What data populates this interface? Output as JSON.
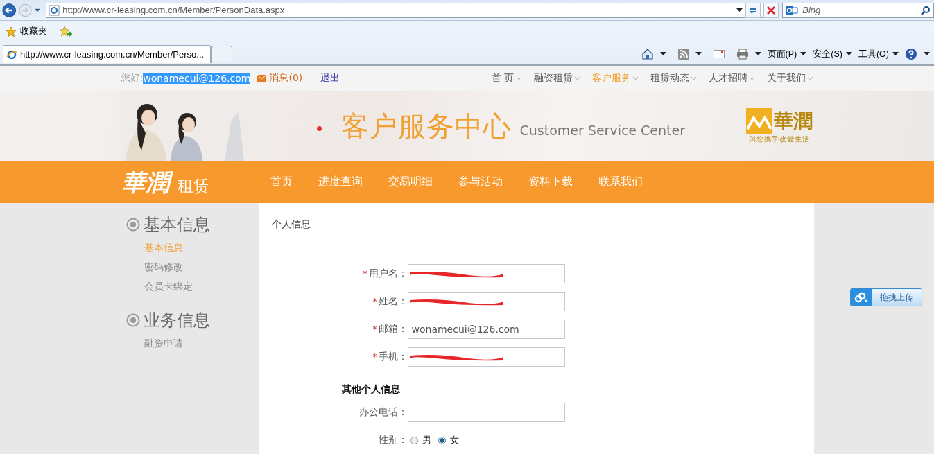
{
  "browser": {
    "address": "http://www.cr-leasing.com.cn/Member/PersonData.aspx",
    "search_placeholder": "Bing",
    "favorites_label": "收藏夹",
    "tab_title": "http://www.cr-leasing.com.cn/Member/Perso...",
    "command_menus": [
      "页面(P)",
      "安全(S)",
      "工具(O)"
    ]
  },
  "top_bar": {
    "greeting": "您好:",
    "username": "wonamecui@126.com",
    "username_selected": true,
    "messages": "消息(0)",
    "logout": "退出",
    "menu": [
      {
        "label": "首 页",
        "selected": false
      },
      {
        "label": "融资租赁",
        "selected": false
      },
      {
        "label": "客户服务",
        "selected": true
      },
      {
        "label": "租赁动态",
        "selected": false
      },
      {
        "label": "人才招聘",
        "selected": false
      },
      {
        "label": "关于我们",
        "selected": false
      }
    ]
  },
  "banner": {
    "title": "客户服务中心",
    "subtitle": "Customer Service Center",
    "logo_mark": "華潤",
    "logo_tagline": "與您攜手改變生活"
  },
  "nav": {
    "brand": "華潤",
    "brand_suffix": "租赁",
    "items": [
      "首页",
      "进度查询",
      "交易明细",
      "参与活动",
      "资料下载",
      "联系我们"
    ]
  },
  "sidebar": {
    "sections": [
      {
        "title": "基本信息",
        "items": [
          {
            "label": "基本信息",
            "selected": true
          },
          {
            "label": "密码修改",
            "selected": false
          },
          {
            "label": "会员卡绑定",
            "selected": false
          }
        ]
      },
      {
        "title": "业务信息",
        "items": [
          {
            "label": "融资申请",
            "selected": false
          }
        ]
      }
    ]
  },
  "form": {
    "section_title": "个人信息",
    "required_mark": "*",
    "fields": [
      {
        "label": "用户名：",
        "required": true,
        "redacted": true
      },
      {
        "label": "姓名：",
        "required": true,
        "redacted": true
      },
      {
        "label": "邮箱：",
        "required": true,
        "redacted": false,
        "value": "wonamecui@126.com"
      },
      {
        "label": "手机：",
        "required": true,
        "redacted": true
      }
    ],
    "other_heading": "其他个人信息",
    "other_fields": [
      {
        "label": "办公电话：",
        "required": false,
        "redacted": false
      }
    ],
    "gender": {
      "label": "性别：",
      "options": [
        {
          "label": "男",
          "selected": false
        },
        {
          "label": "女",
          "selected": true
        }
      ]
    }
  },
  "upload_button": "拖拽上传"
}
